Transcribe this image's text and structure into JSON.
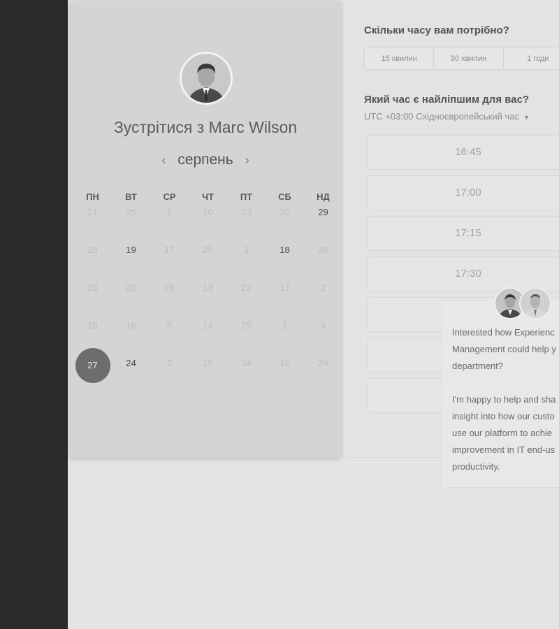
{
  "meeting": {
    "title": "Зустрітися з Marc Wilson",
    "avatar_alt": "Marc Wilson"
  },
  "calendar": {
    "month": "серпень",
    "prev_icon": "‹",
    "next_icon": "›",
    "weekdays": [
      "ПН",
      "ВТ",
      "СР",
      "ЧТ",
      "ПТ",
      "СБ",
      "НД"
    ],
    "weeks": [
      [
        {
          "d": "21",
          "a": false
        },
        {
          "d": "25",
          "a": false
        },
        {
          "d": "2",
          "a": false
        },
        {
          "d": "10",
          "a": false
        },
        {
          "d": "23",
          "a": false
        },
        {
          "d": "20",
          "a": false
        },
        {
          "d": "29",
          "a": true
        }
      ],
      [
        {
          "d": "28",
          "a": false
        },
        {
          "d": "19",
          "a": true
        },
        {
          "d": "17",
          "a": false
        },
        {
          "d": "25",
          "a": false
        },
        {
          "d": "1",
          "a": false
        },
        {
          "d": "18",
          "a": true
        },
        {
          "d": "24",
          "a": false
        }
      ],
      [
        {
          "d": "26",
          "a": false
        },
        {
          "d": "29",
          "a": false
        },
        {
          "d": "28",
          "a": false
        },
        {
          "d": "13",
          "a": false
        },
        {
          "d": "22",
          "a": false
        },
        {
          "d": "17",
          "a": false
        },
        {
          "d": "2",
          "a": false
        }
      ],
      [
        {
          "d": "10",
          "a": false
        },
        {
          "d": "16",
          "a": false
        },
        {
          "d": "5",
          "a": false
        },
        {
          "d": "14",
          "a": false
        },
        {
          "d": "25",
          "a": false
        },
        {
          "d": "1",
          "a": false
        },
        {
          "d": "4",
          "a": false
        }
      ],
      [
        {
          "d": "27",
          "a": true,
          "selected": true
        },
        {
          "d": "24",
          "a": true
        },
        {
          "d": "2",
          "a": false
        },
        {
          "d": "15",
          "a": false
        },
        {
          "d": "24",
          "a": false
        },
        {
          "d": "16",
          "a": false
        },
        {
          "d": "29",
          "a": false
        }
      ]
    ]
  },
  "duration": {
    "question": "Скільки часу вам потрібно?",
    "options": [
      "15 хвилин",
      "30 хвилин",
      "1 годи"
    ]
  },
  "time": {
    "question": "Який час є найліпшим для вас?",
    "timezone": "UTC +03:00 Східноєвропейський час",
    "slots": [
      "16:45",
      "17:00",
      "17:15",
      "17:30",
      "",
      "",
      ""
    ]
  },
  "chat": {
    "paragraph1": [
      "Interested how Experienc",
      "Management could help y",
      "department?"
    ],
    "paragraph2": [
      "I'm happy to help and sha",
      "insight into how our custo",
      "use our platform to achie",
      "improvement in IT end-us",
      "productivity."
    ]
  },
  "colors": {
    "rail": "#2a2a2a",
    "selected_day": "#6d6d6d"
  }
}
